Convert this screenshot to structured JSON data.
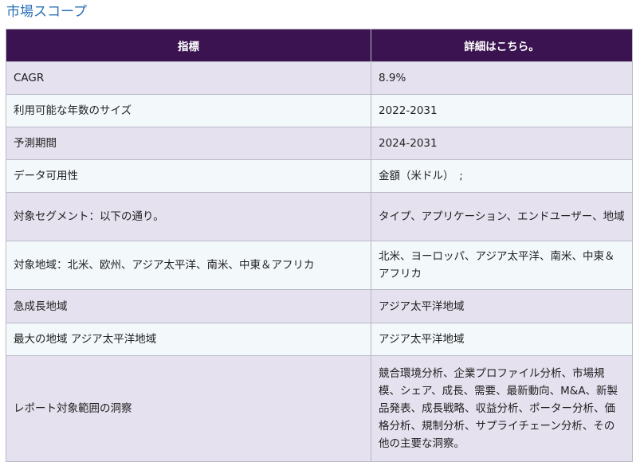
{
  "heading": "市場スコープ",
  "table": {
    "headers": [
      "指標",
      "詳細はこちら。"
    ],
    "rows": [
      [
        "CAGR",
        "8.9%"
      ],
      [
        "利用可能な年数のサイズ",
        "2022-2031"
      ],
      [
        "予測期間",
        "2024-2031"
      ],
      [
        "データ可用性",
        "金額（米ドル）　;"
      ],
      [
        "対象セグメント：以下の通り。",
        "タイプ、アプリケーション、エンドユーザー、地域"
      ],
      [
        "対象地域：北米、欧州、アジア太平洋、南米、中東＆アフリカ",
        "北米、ヨーロッパ、アジア太平洋、南米、中東＆アフリカ"
      ],
      [
        "急成長地域",
        "アジア太平洋地域"
      ],
      [
        "最大の地域 アジア太平洋地域",
        "アジア太平洋地域"
      ],
      [
        "レポート対象範囲の洞察",
        "競合環境分析、企業プロファイル分析、市場規模、シェア、成長、需要、最新動向、M&A、新製品発表、成長戦略、収益分析、ポーター分析、価格分析、規制分析、サプライチェーン分析、その他の主要な洞察。"
      ]
    ]
  },
  "colors": {
    "heading": "#2a6fb5",
    "header_bg": "#3b1350",
    "row_odd": "#e5e1ef",
    "row_even": "#f3f8fb",
    "border": "#b9b9c6"
  }
}
